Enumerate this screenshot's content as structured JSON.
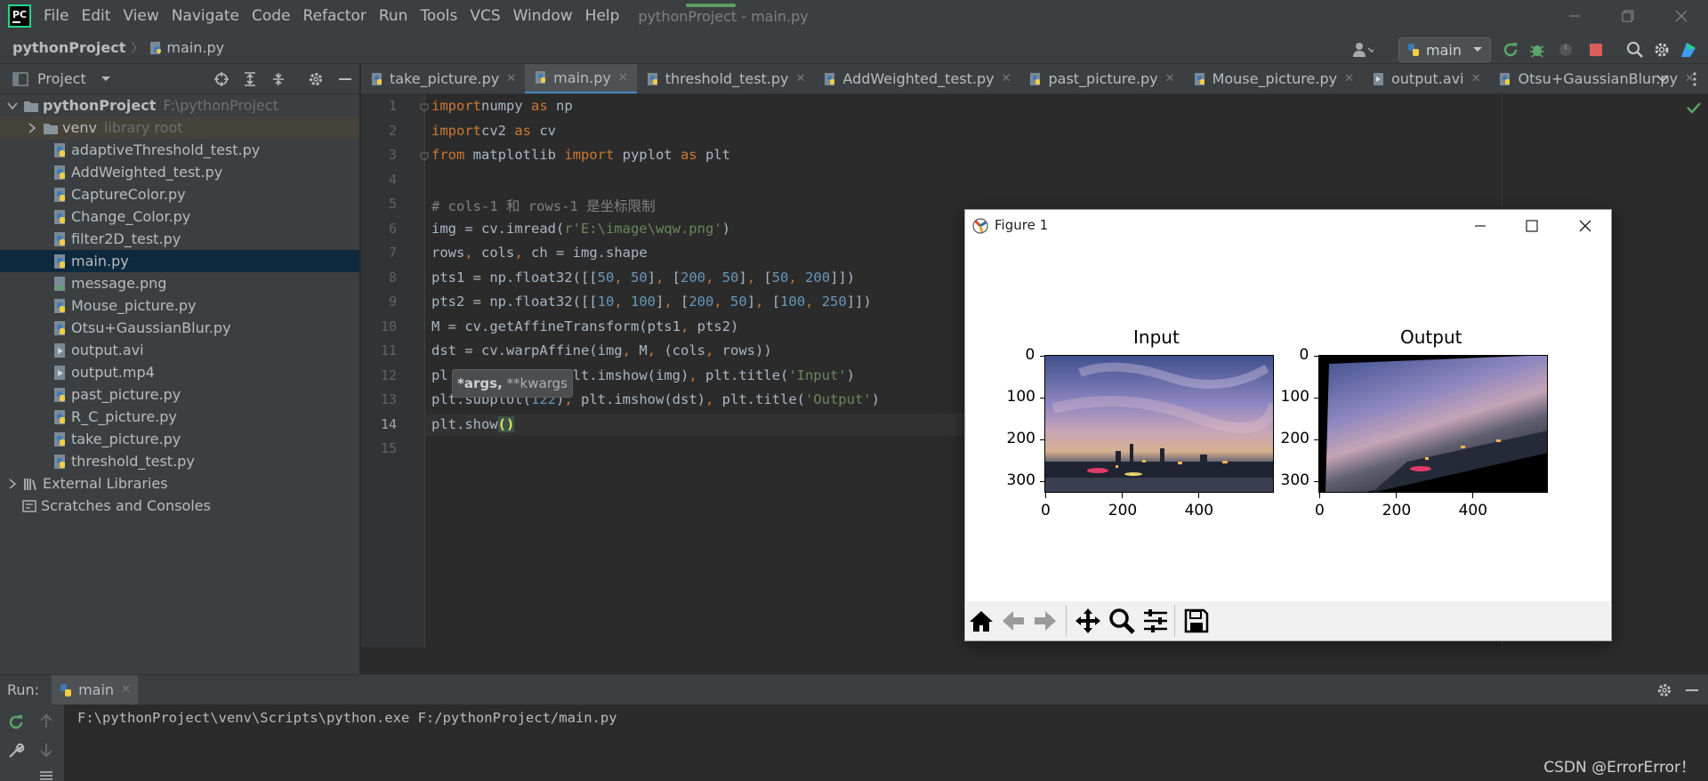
{
  "menu": [
    "File",
    "Edit",
    "View",
    "Navigate",
    "Code",
    "Refactor",
    "Run",
    "Tools",
    "VCS",
    "Window",
    "Help"
  ],
  "window_title": "pythonProject - main.py",
  "breadcrumb": {
    "project": "pythonProject",
    "file": "main.py"
  },
  "run_config": "main",
  "project_panel": {
    "title": "Project",
    "root": "pythonProject",
    "root_path": "F:\\pythonProject",
    "venv": "venv",
    "venv_note": "library root",
    "files": [
      "adaptiveThreshold_test.py",
      "AddWeighted_test.py",
      "CaptureColor.py",
      "Change_Color.py",
      "filter2D_test.py",
      "main.py",
      "message.png",
      "Mouse_picture.py",
      "Otsu+GaussianBlur.py",
      "output.avi",
      "output.mp4",
      "past_picture.py",
      "R_C_picture.py",
      "take_picture.py",
      "threshold_test.py"
    ],
    "external": "External Libraries",
    "scratches": "Scratches and Consoles"
  },
  "tabs": [
    "take_picture.py",
    "main.py",
    "threshold_test.py",
    "AddWeighted_test.py",
    "past_picture.py",
    "Mouse_picture.py",
    "output.avi",
    "Otsu+GaussianBlur.py"
  ],
  "editor": {
    "line_numbers": [
      "1",
      "2",
      "3",
      "4",
      "5",
      "6",
      "7",
      "8",
      "9",
      "10",
      "11",
      "12",
      "13",
      "14",
      "15"
    ],
    "tooltip_bold": "*args,",
    "tooltip_rest": " **kwargs",
    "lines": [
      [
        [
          "kw",
          "import"
        ],
        [
          "",
          "numpy "
        ],
        [
          "kw",
          "as"
        ],
        [
          "",
          " np"
        ]
      ],
      [
        [
          "kw",
          "import"
        ],
        [
          "",
          "cv2 "
        ],
        [
          "kw",
          "as"
        ],
        [
          "",
          " cv"
        ]
      ],
      [
        [
          "kw",
          "from"
        ],
        [
          "",
          " matplotlib "
        ],
        [
          "kw",
          "import"
        ],
        [
          "",
          " pyplot "
        ],
        [
          "kw",
          "as"
        ],
        [
          "",
          " plt"
        ]
      ],
      [],
      [
        [
          "com",
          "# cols-1 和 rows-1 是坐标限制"
        ]
      ],
      [
        [
          "",
          "img = cv.imread("
        ],
        [
          "str",
          "r'E:\\image\\wqw.png'"
        ],
        [
          "",
          ")"
        ]
      ],
      [
        [
          "",
          "rows"
        ],
        [
          "kw",
          ","
        ],
        [
          "",
          " cols"
        ],
        [
          "kw",
          ","
        ],
        [
          "",
          " ch = img.shape"
        ]
      ],
      [
        [
          "",
          "pts1 = np.float32([["
        ],
        [
          "num",
          "50"
        ],
        [
          "kw",
          ","
        ],
        [
          " ",
          ""
        ],
        [
          "num",
          " 50"
        ],
        [
          "",
          "]"
        ],
        [
          "kw",
          ","
        ],
        [
          "",
          " ["
        ],
        [
          "num",
          "200"
        ],
        [
          "kw",
          ","
        ],
        [
          "num",
          " 50"
        ],
        [
          "",
          "]"
        ],
        [
          "kw",
          ","
        ],
        [
          "",
          " ["
        ],
        [
          "num",
          "50"
        ],
        [
          "kw",
          ","
        ],
        [
          "num",
          " 200"
        ],
        [
          "",
          "]])"
        ]
      ],
      [
        [
          "",
          "pts2 = np.float32([["
        ],
        [
          "num",
          "10"
        ],
        [
          "kw",
          ","
        ],
        [
          "num",
          " 100"
        ],
        [
          "",
          "]"
        ],
        [
          "kw",
          ","
        ],
        [
          "",
          " ["
        ],
        [
          "num",
          "200"
        ],
        [
          "kw",
          ","
        ],
        [
          "num",
          " 50"
        ],
        [
          "",
          "]"
        ],
        [
          "kw",
          ","
        ],
        [
          "",
          " ["
        ],
        [
          "num",
          "100"
        ],
        [
          "kw",
          ","
        ],
        [
          "num",
          " 250"
        ],
        [
          "",
          "]])"
        ]
      ],
      [
        [
          "",
          "M = cv.getAffineTransform(pts1"
        ],
        [
          "kw",
          ","
        ],
        [
          "",
          " pts2)"
        ]
      ],
      [
        [
          "",
          "dst = cv.warpAffine(img"
        ],
        [
          "kw",
          ","
        ],
        [
          "",
          " M"
        ],
        [
          "kw",
          ","
        ],
        [
          "",
          " (cols"
        ],
        [
          "kw",
          ","
        ],
        [
          "",
          " rows))"
        ]
      ],
      [
        [
          "",
          "pl"
        ],
        [
          "",
          "            "
        ],
        [
          "kw",
          ","
        ],
        [
          "",
          " plt.imshow(img)"
        ],
        [
          "kw",
          ","
        ],
        [
          "",
          " plt.title("
        ],
        [
          "str",
          "'Input'"
        ],
        [
          "",
          ")"
        ]
      ],
      [
        [
          "",
          "plt.subplot("
        ],
        [
          "num",
          "122"
        ],
        [
          "",
          ")"
        ],
        [
          "kw",
          ","
        ],
        [
          "",
          " plt.imshow(dst)"
        ],
        [
          "kw",
          ","
        ],
        [
          "",
          " plt.title("
        ],
        [
          "str",
          "'Output'"
        ],
        [
          "",
          ")"
        ]
      ],
      [
        [
          "",
          "plt.show"
        ],
        [
          "",
          "()"
        ]
      ],
      []
    ]
  },
  "figure": {
    "title": "Figure 1",
    "toolbar": [
      "home-icon",
      "back-icon",
      "forward-icon",
      "pan-icon",
      "zoom-icon",
      "configure-icon",
      "save-icon"
    ]
  },
  "chart_data": [
    {
      "type": "image",
      "title": "Input",
      "xticks": [
        "0",
        "200",
        "400"
      ],
      "yticks": [
        "0",
        "100",
        "200",
        "300"
      ],
      "xlim": [
        0,
        600
      ],
      "ylim": [
        360,
        0
      ]
    },
    {
      "type": "image",
      "title": "Output",
      "xticks": [
        "0",
        "200",
        "400"
      ],
      "yticks": [
        "0",
        "100",
        "200",
        "300"
      ],
      "xlim": [
        0,
        600
      ],
      "ylim": [
        360,
        0
      ]
    }
  ],
  "run_panel": {
    "label": "Run:",
    "tab": "main",
    "command": "F:\\pythonProject\\venv\\Scripts\\python.exe F:/pythonProject/main.py"
  },
  "watermark": "CSDN @ErrorError！"
}
